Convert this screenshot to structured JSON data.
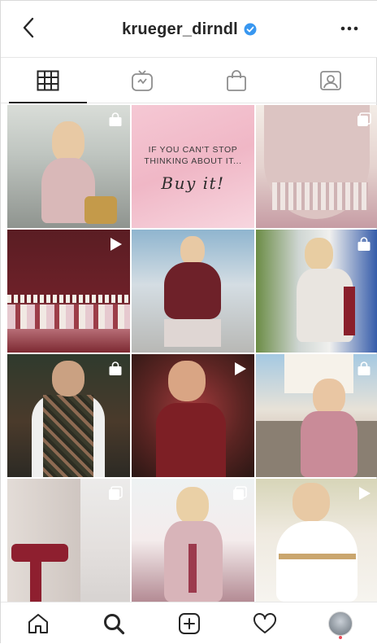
{
  "header": {
    "username": "krueger_dirndl",
    "back_icon": "chevron-left-icon",
    "verified_icon": "verified-badge-icon",
    "more_icon": "more-horizontal-icon",
    "verified_color": "#3897f0"
  },
  "tabs": [
    {
      "name": "grid",
      "icon": "grid-icon",
      "active": true
    },
    {
      "name": "igtv",
      "icon": "igtv-icon",
      "active": false
    },
    {
      "name": "shop",
      "icon": "shopping-bag-icon",
      "active": false
    },
    {
      "name": "tagged",
      "icon": "tagged-icon",
      "active": false
    }
  ],
  "grid": {
    "posts": [
      {
        "badge": "shopping-bag-icon"
      },
      {
        "badge": "",
        "quote_line1": "IF YOU CAN'T STOP",
        "quote_line2": "THINKING ABOUT IT...",
        "quote_script": "Buy it!"
      },
      {
        "badge": "carousel-icon"
      },
      {
        "badge": "video-play-icon"
      },
      {
        "badge": ""
      },
      {
        "badge": "shopping-bag-icon"
      },
      {
        "badge": "shopping-bag-icon"
      },
      {
        "badge": "video-play-icon"
      },
      {
        "badge": "shopping-bag-icon"
      },
      {
        "badge": "carousel-icon"
      },
      {
        "badge": "carousel-icon"
      },
      {
        "badge": "video-play-icon"
      }
    ]
  },
  "bottom_nav": {
    "items": [
      "home-icon",
      "search-icon",
      "new-post-icon",
      "activity-heart-icon",
      "profile-avatar"
    ],
    "active": "search-icon",
    "notification_dot_color": "#ed4956"
  }
}
